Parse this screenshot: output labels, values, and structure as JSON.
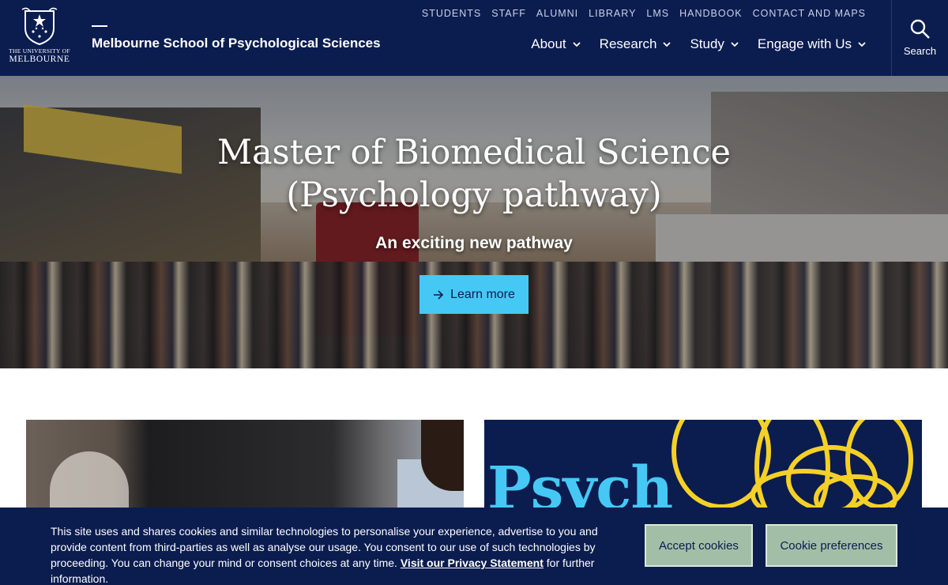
{
  "header": {
    "logo": {
      "line1": "THE UNIVERSITY OF",
      "line2": "MELBOURNE",
      "icon": "university-crest"
    },
    "site_title": "Melbourne School of Psychological Sciences",
    "utility_links": [
      "STUDENTS",
      "STAFF",
      "ALUMNI",
      "LIBRARY",
      "LMS",
      "HANDBOOK",
      "CONTACT AND MAPS"
    ],
    "main_nav": [
      {
        "label": "About"
      },
      {
        "label": "Research"
      },
      {
        "label": "Study"
      },
      {
        "label": "Engage with Us"
      }
    ],
    "search_label": "Search"
  },
  "hero": {
    "title_line1": "Master of Biomedical Science",
    "title_line2": "(Psychology pathway)",
    "subtitle": "An exciting new pathway",
    "button_label": "Learn more",
    "button_color": "#46c8f5"
  },
  "cards": {
    "right_word": "Psych"
  },
  "cookie_banner": {
    "text_before_link": "This site uses and shares cookies and similar technologies to personalise your experience, advertise to you and provide content from third-parties as well as analyse our usage. You consent to our use of such technologies by proceeding. You can change your mind or consent choices at any time. ",
    "link_label": "Visit our Privacy Statement",
    "text_after_link": " for further information.",
    "accept_label": "Accept cookies",
    "preferences_label": "Cookie preferences"
  },
  "colors": {
    "navy": "#0b1c4f",
    "accent_blue": "#46c8f5",
    "accent_yellow": "#f5d027",
    "cookie_button": "#a2bea7"
  }
}
